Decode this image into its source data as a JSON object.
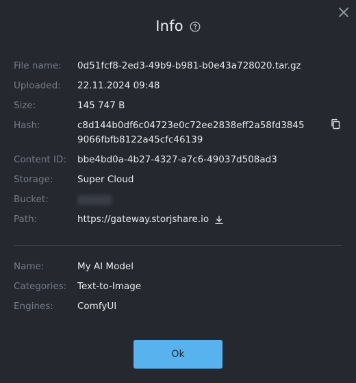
{
  "dialog": {
    "title": "Info",
    "ok_label": "Ok"
  },
  "file": {
    "file_name_label": "File name:",
    "file_name": "0d51fcf8-2ed3-49b9-b981-b0e43a728020.tar.gz",
    "uploaded_label": "Uploaded:",
    "uploaded": "22.11.2024 09:48",
    "size_label": "Size:",
    "size": "145 747 B",
    "hash_label": "Hash:",
    "hash": "c8d144b0df6c04723e0c72ee2838eff2a58fd38459066fbfb8122a45cfc46139",
    "content_id_label": "Content ID:",
    "content_id": "bbe4bd0a-4b27-4327-a7c6-49037d508ad3",
    "storage_label": "Storage:",
    "storage": "Super Cloud",
    "bucket_label": "Bucket:",
    "path_label": "Path:",
    "path": "https://gateway.storjshare.io"
  },
  "model": {
    "name_label": "Name:",
    "name": "My AI Model",
    "categories_label": "Categories:",
    "categories": "Text-to-Image",
    "engines_label": "Engines:",
    "engines": "ComfyUI"
  },
  "colors": {
    "background": "#25282f",
    "accent": "#58b2ee",
    "label": "#767b86",
    "value": "#e6e8ec"
  },
  "icons": {
    "close": "close-icon",
    "help": "help-circle-icon",
    "copy": "copy-icon",
    "download": "download-icon"
  }
}
